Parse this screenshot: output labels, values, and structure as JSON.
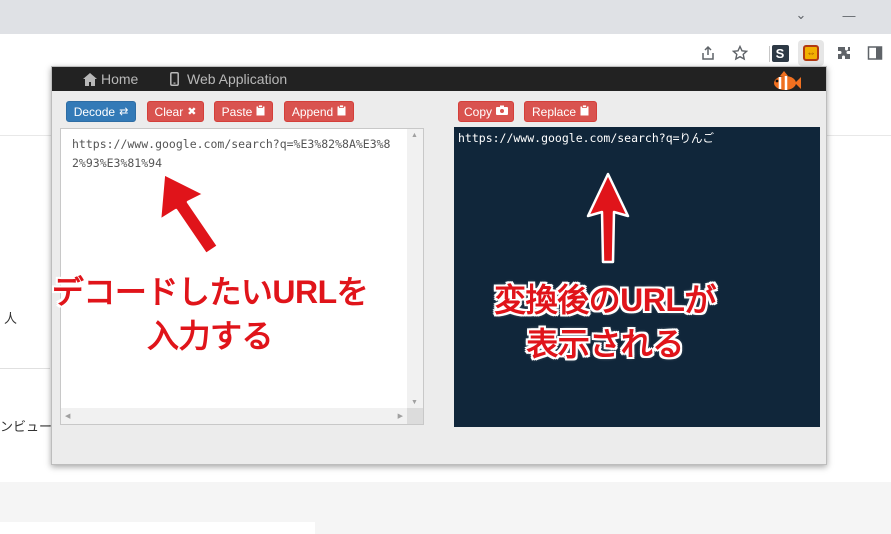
{
  "browser": {
    "window_controls": {
      "dropdown": "⌄",
      "minimize": "—"
    }
  },
  "background_page": {
    "text1": "人",
    "text2": "ンビュー"
  },
  "popup": {
    "nav": {
      "home_label": "Home",
      "webapp_label": "Web Application",
      "logo_icon": "clownfish-icon"
    },
    "left_buttons": [
      {
        "label": "Decode",
        "icon": "⇄"
      },
      {
        "label": "Clear",
        "icon": "✖"
      },
      {
        "label": "Paste",
        "icon": "📋"
      },
      {
        "label": "Append",
        "icon": "📋"
      }
    ],
    "right_buttons": [
      {
        "label": "Copy",
        "icon": "📷"
      },
      {
        "label": "Replace",
        "icon": "📋"
      }
    ],
    "input_value": "https://www.google.com/search?q=%E3%82%8A%E3%82%93%E3%81%94",
    "output_value": "https://www.google.com/search?q=りんご"
  },
  "annotations": {
    "left_line1": "デコードしたいURLを",
    "left_line2": "入力する",
    "right_line1": "変換後のURLが",
    "right_line2": "表示される"
  },
  "colors": {
    "nav_bg": "#222222",
    "btn_blue": "#337ab7",
    "btn_red": "#d9534f",
    "output_bg": "#10263a",
    "annotation_red": "#e0141a"
  }
}
